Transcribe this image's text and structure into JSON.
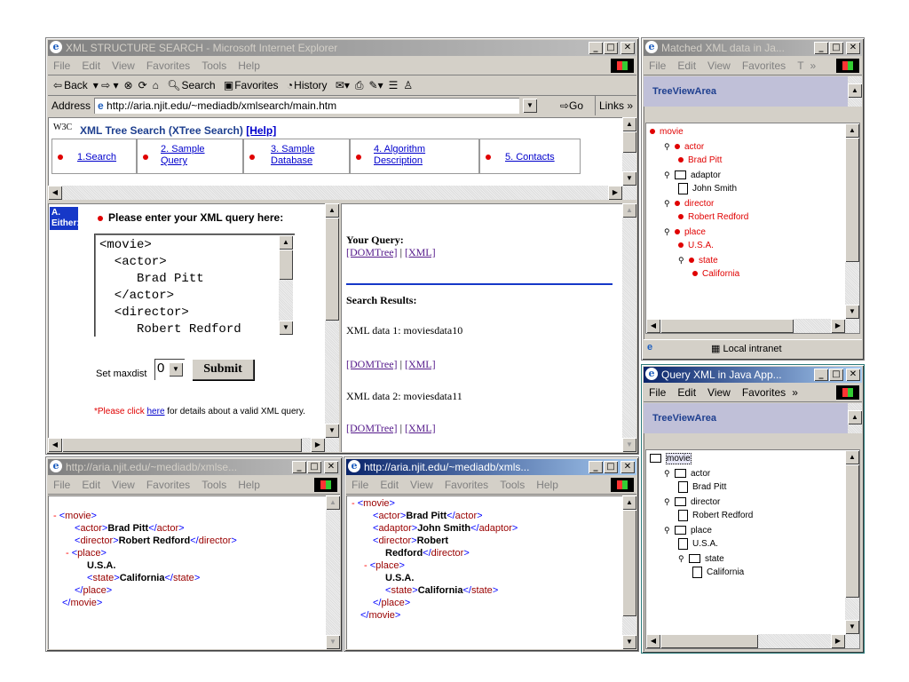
{
  "main_window": {
    "title": "XML STRUCTURE SEARCH - Microsoft Internet Explorer",
    "menu": [
      "File",
      "Edit",
      "View",
      "Favorites",
      "Tools",
      "Help"
    ],
    "toolbar": [
      "Back",
      "Search",
      "Favorites",
      "History"
    ],
    "address_label": "Address",
    "address": "http://aria.njit.edu/~mediadb/xmlsearch/main.htm",
    "go_label": "Go",
    "links_label": "Links",
    "header": {
      "logo": "W3C",
      "title": "XML Tree Search (XTree Search)",
      "help": "[Help]",
      "nav": [
        "1.Search",
        "2. Sample Query",
        "3. Sample Database",
        "4. Algorithm Description",
        "5. Contacts"
      ]
    },
    "left_frame": {
      "badge": "A. Either:",
      "prompt": "Please enter your XML query here:",
      "query_lines": [
        "<movie>",
        "  <actor>",
        "     Brad Pitt",
        "  </actor>",
        "  <director>",
        "     Robert Redford"
      ],
      "maxdist_label": "Set maxdist",
      "maxdist_value": "0",
      "submit_label": "Submit",
      "note_prefix": "*Please click",
      "note_link": "here",
      "note_suffix": "for details about a valid XML query."
    },
    "right_frame": {
      "your_query_label": "Your Query:",
      "domtree_link": "[DOMTree]",
      "sep": "|",
      "xml_link": "[XML]",
      "results_label": "Search Results:",
      "results": [
        {
          "label": "XML data 1: moviesdata10",
          "dom": "[DOMTree]",
          "xml": "[XML]"
        },
        {
          "label": "XML data 2: moviesdata11",
          "dom": "[DOMTree]",
          "xml": "[XML]"
        }
      ]
    }
  },
  "matched_window": {
    "title": "Matched XML data in Ja...",
    "menu": [
      "File",
      "Edit",
      "View",
      "Favorites",
      "T"
    ],
    "header": "TreeViewArea",
    "tree": [
      {
        "label": "movie",
        "depth": 0,
        "kind": "dot"
      },
      {
        "label": "actor",
        "depth": 1,
        "kind": "dot"
      },
      {
        "label": "Brad Pitt",
        "depth": 2,
        "kind": "dot"
      },
      {
        "label": "adaptor",
        "depth": 1,
        "kind": "folder"
      },
      {
        "label": "John Smith",
        "depth": 2,
        "kind": "doc"
      },
      {
        "label": "director",
        "depth": 1,
        "kind": "dot"
      },
      {
        "label": "Robert Redford",
        "depth": 2,
        "kind": "dot"
      },
      {
        "label": "place",
        "depth": 1,
        "kind": "dot"
      },
      {
        "label": "U.S.A.",
        "depth": 2,
        "kind": "dot"
      },
      {
        "label": "state",
        "depth": 2,
        "kind": "dot"
      },
      {
        "label": "California",
        "depth": 3,
        "kind": "dot"
      }
    ],
    "status": "Local intranet"
  },
  "query_window": {
    "title": "Query XML in Java App...",
    "menu": [
      "File",
      "Edit",
      "View",
      "Favorites"
    ],
    "header": "TreeViewArea",
    "tree": [
      {
        "label": "movie",
        "depth": 0
      },
      {
        "label": "actor",
        "depth": 1,
        "kind": "folder"
      },
      {
        "label": "Brad Pitt",
        "depth": 2,
        "kind": "doc"
      },
      {
        "label": "director",
        "depth": 1,
        "kind": "folder"
      },
      {
        "label": "Robert Redford",
        "depth": 2,
        "kind": "doc"
      },
      {
        "label": "place",
        "depth": 1,
        "kind": "folder"
      },
      {
        "label": "U.S.A.",
        "depth": 2,
        "kind": "doc"
      },
      {
        "label": "state",
        "depth": 2,
        "kind": "folder"
      },
      {
        "label": "California",
        "depth": 3,
        "kind": "doc"
      }
    ]
  },
  "xml_window_1": {
    "title": "http://aria.njit.edu/~mediadb/xmlse...",
    "menu": [
      "File",
      "Edit",
      "View",
      "Favorites",
      "Tools",
      "Help"
    ],
    "lines": [
      {
        "minus": "-",
        "open": "movie",
        "indent": 0
      },
      {
        "open": "actor",
        "text": "Brad Pitt",
        "close": "actor",
        "indent": 1
      },
      {
        "open": "director",
        "text": "Robert Redford",
        "close": "director",
        "indent": 1
      },
      {
        "minus": "-",
        "open": "place",
        "indent": 1
      },
      {
        "text": "U.S.A.",
        "indent": 2
      },
      {
        "open": "state",
        "text": "California",
        "close": "state",
        "indent": 2
      },
      {
        "close": "place",
        "indent": 1
      },
      {
        "close": "movie",
        "indent": 0
      }
    ]
  },
  "xml_window_2": {
    "title": "http://aria.njit.edu/~mediadb/xmls...",
    "menu": [
      "File",
      "Edit",
      "View",
      "Favorites",
      "Tools",
      "Help"
    ],
    "lines": [
      {
        "minus": "-",
        "open": "movie",
        "indent": 0
      },
      {
        "open": "actor",
        "text": "Brad Pitt",
        "close": "actor",
        "indent": 1
      },
      {
        "open": "adaptor",
        "text": "John Smith",
        "close": "adaptor",
        "indent": 1
      },
      {
        "open": "director",
        "text": "Robert",
        "indent": 1
      },
      {
        "text": "Redford",
        "close": "director",
        "indent": 2
      },
      {
        "minus": "-",
        "open": "place",
        "indent": 1
      },
      {
        "text": "U.S.A.",
        "indent": 2
      },
      {
        "open": "state",
        "text": "California",
        "close": "state",
        "indent": 2
      },
      {
        "close": "place",
        "indent": 1
      },
      {
        "close": "movie",
        "indent": 0
      }
    ]
  }
}
